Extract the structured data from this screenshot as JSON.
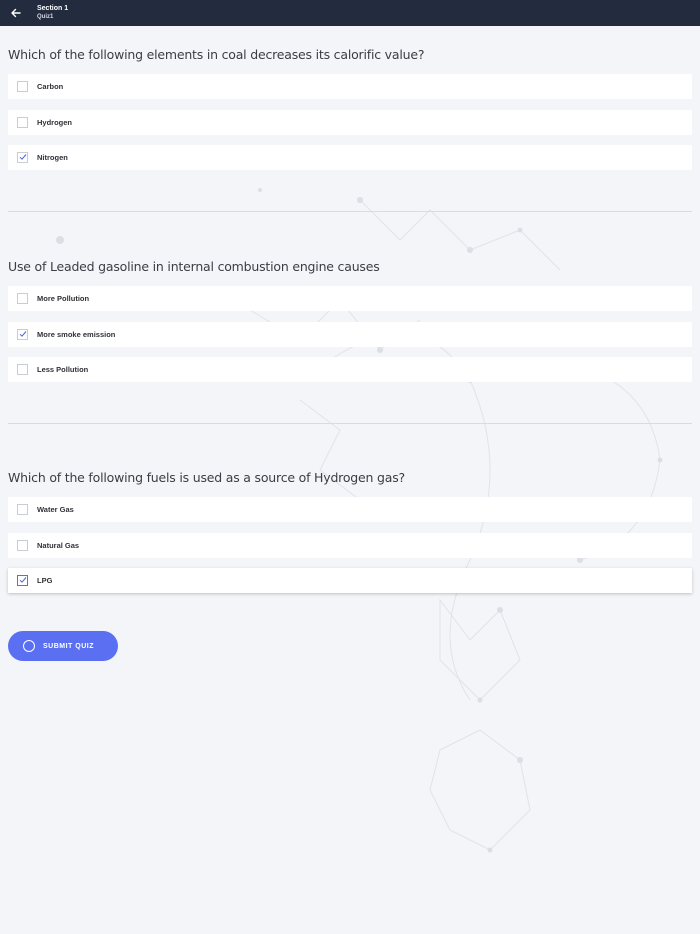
{
  "header": {
    "section": "Section 1",
    "quiz": "Quiz1"
  },
  "questions": [
    {
      "text": "Which of the following elements in coal decreases its calorific value?",
      "options": [
        {
          "label": "Carbon",
          "checked": false
        },
        {
          "label": "Hydrogen",
          "checked": false
        },
        {
          "label": "Nitrogen",
          "checked": true
        }
      ]
    },
    {
      "text": "Use of Leaded gasoline in internal combustion engine causes",
      "options": [
        {
          "label": "More Pollution",
          "checked": false
        },
        {
          "label": "More smoke emission",
          "checked": true
        },
        {
          "label": "Less Pollution",
          "checked": false
        }
      ]
    },
    {
      "text": "Which of the following fuels is used as a source of Hydrogen gas?",
      "options": [
        {
          "label": "Water Gas",
          "checked": false
        },
        {
          "label": "Natural Gas",
          "checked": false
        },
        {
          "label": "LPG",
          "checked": true
        }
      ]
    }
  ],
  "submit": {
    "label": "SUBMIT QUIZ"
  },
  "colors": {
    "header_bg": "#232b3e",
    "page_bg": "#f4f5f8",
    "accent": "#5b6ff2"
  },
  "icons": {
    "back": "arrow-left-icon",
    "check": "checkmark-icon",
    "submit": "circle-icon"
  }
}
